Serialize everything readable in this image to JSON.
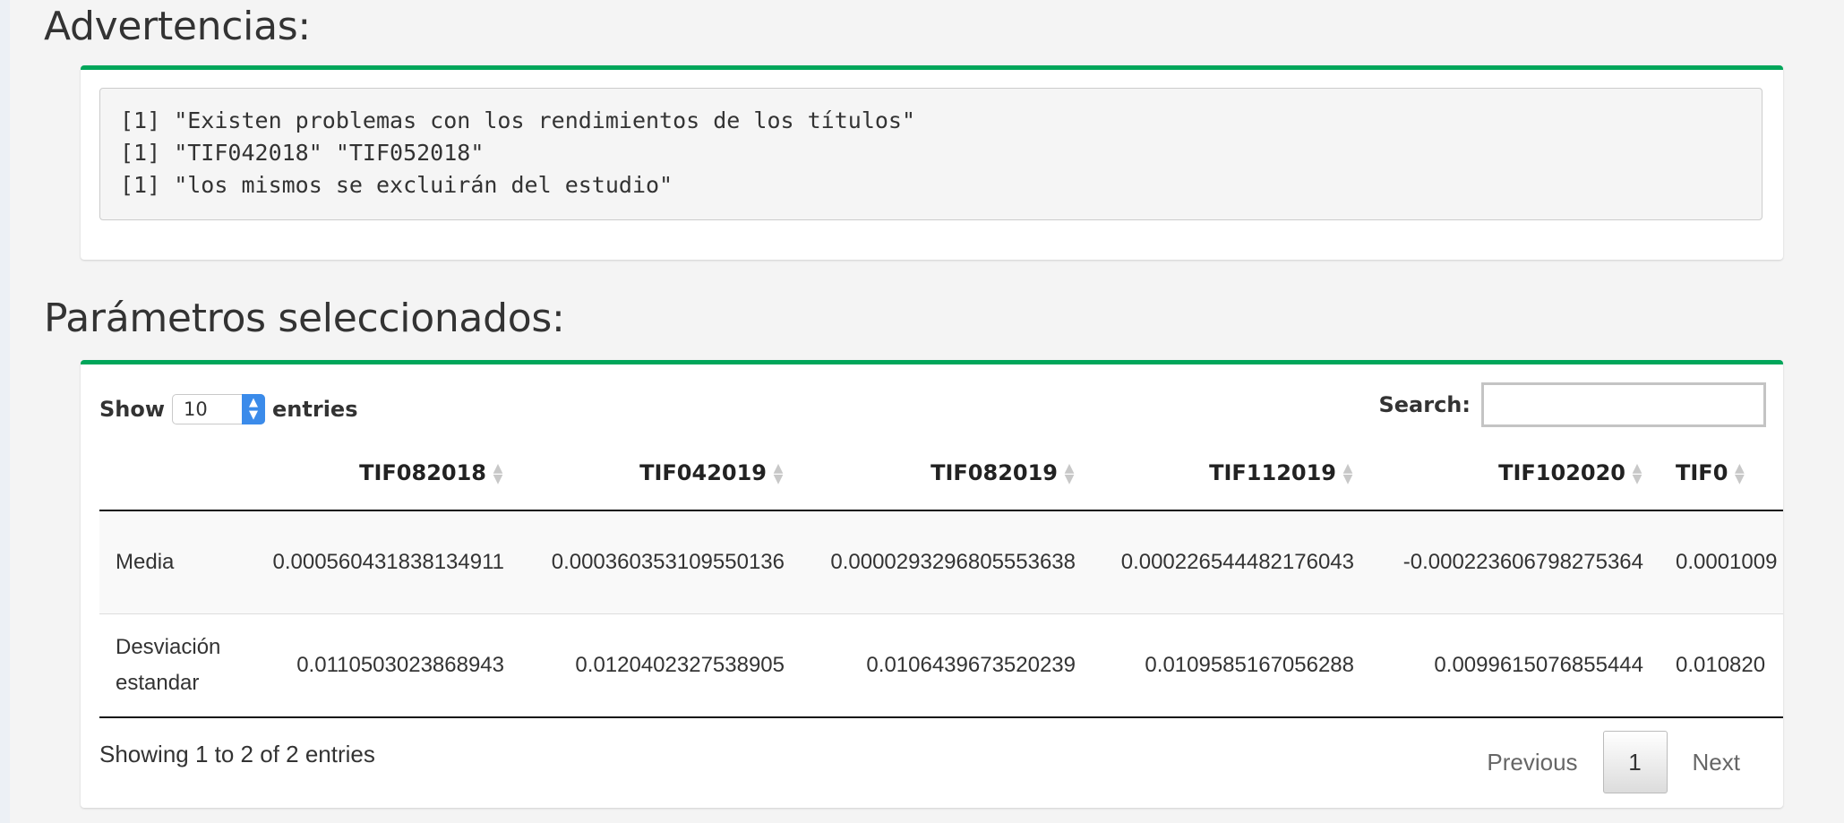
{
  "warnings": {
    "title": "Advertencias:",
    "lines": [
      "[1] \"Existen problemas con los rendimientos de los títulos\"",
      "[1] \"TIF042018\" \"TIF052018\"",
      "[1] \"los mismos se excluirán del estudio\""
    ]
  },
  "params": {
    "title": "Parámetros seleccionados:",
    "show_label": "Show",
    "entries_label": "entries",
    "page_length": "10",
    "search_label": "Search:",
    "search_value": "",
    "columns": [
      "",
      "TIF082018",
      "TIF042019",
      "TIF082019",
      "TIF112019",
      "TIF102020",
      "TIF0"
    ],
    "rows": [
      [
        "Media",
        "0.000560431838134911",
        "0.000360353109550136",
        "0.0000293296805553638",
        "0.000226544482176043",
        "-0.000223606798275364",
        "0.0001009"
      ],
      [
        "Desviación estandar",
        "0.0110503023868943",
        "0.0120402327538905",
        "0.0106439673520239",
        "0.0109585167056288",
        "0.0099615076855444",
        "0.010820"
      ]
    ],
    "info": "Showing 1 to 2 of 2 entries",
    "pagination": {
      "previous": "Previous",
      "current": "1",
      "next": "Next"
    }
  },
  "colors": {
    "accent": "#00a65a",
    "select_arrow": "#3b8bea"
  }
}
